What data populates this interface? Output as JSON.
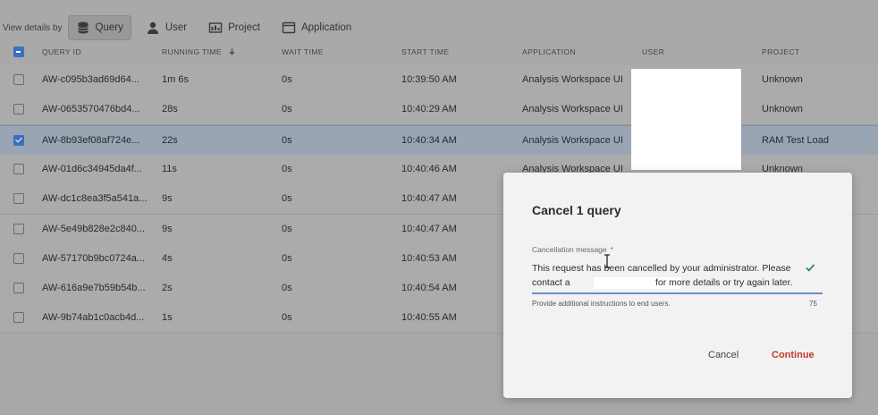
{
  "viewbar": {
    "label": "View details by",
    "buttons": [
      {
        "label": "Query",
        "icon": "database-icon",
        "active": true
      },
      {
        "label": "User",
        "icon": "user-icon",
        "active": false
      },
      {
        "label": "Project",
        "icon": "project-icon",
        "active": false
      },
      {
        "label": "Application",
        "icon": "application-icon",
        "active": false
      }
    ]
  },
  "table": {
    "headers": {
      "query_id": "QUERY ID",
      "running_time": "RUNNING TIME",
      "wait_time": "WAIT TIME",
      "start_time": "START TIME",
      "application": "APPLICATION",
      "user": "USER",
      "project": "PROJECT"
    },
    "sort_icon": "arrow-down-icon",
    "rows": [
      {
        "query_id": "AW-c095b3ad69d64...",
        "running_time": "1m 6s",
        "wait_time": "0s",
        "start_time": "10:39:50 AM",
        "application": "Analysis Workspace UI",
        "project": "Unknown",
        "checked": false
      },
      {
        "query_id": "AW-0653570476bd4...",
        "running_time": "28s",
        "wait_time": "0s",
        "start_time": "10:40:29 AM",
        "application": "Analysis Workspace UI",
        "project": "Unknown",
        "checked": false
      },
      {
        "query_id": "AW-8b93ef08af724e...",
        "running_time": "22s",
        "wait_time": "0s",
        "start_time": "10:40:34 AM",
        "application": "Analysis Workspace UI",
        "project": "RAM Test Load",
        "checked": true
      },
      {
        "query_id": "AW-01d6c34945da4f...",
        "running_time": "11s",
        "wait_time": "0s",
        "start_time": "10:40:46 AM",
        "application": "Analysis Workspace UI",
        "project": "Unknown",
        "checked": false
      },
      {
        "query_id": "AW-dc1c8ea3f5a541a...",
        "running_time": "9s",
        "wait_time": "0s",
        "start_time": "10:40:47 AM",
        "application": "",
        "project": "",
        "checked": false
      },
      {
        "query_id": "AW-5e49b828e2c840...",
        "running_time": "9s",
        "wait_time": "0s",
        "start_time": "10:40:47 AM",
        "application": "",
        "project": "",
        "checked": false
      },
      {
        "query_id": "AW-57170b9bc0724a...",
        "running_time": "4s",
        "wait_time": "0s",
        "start_time": "10:40:53 AM",
        "application": "",
        "project": "",
        "checked": false
      },
      {
        "query_id": "AW-616a9e7b59b54b...",
        "running_time": "2s",
        "wait_time": "0s",
        "start_time": "10:40:54 AM",
        "application": "",
        "project": "",
        "checked": false
      },
      {
        "query_id": "AW-9b74ab1c0acb4d...",
        "running_time": "1s",
        "wait_time": "0s",
        "start_time": "10:40:55 AM",
        "application": "",
        "project": "",
        "checked": false
      }
    ]
  },
  "dialog": {
    "title": "Cancel 1 query",
    "field_label": "Cancellation message",
    "required_mark": "*",
    "message_line1": "This request has been cancelled by your administrator. Please",
    "message_line2_start": "contact a",
    "message_line2_end": "for more details or try again later.",
    "help_text": "Provide additional instructions to end users.",
    "char_count": "75",
    "cancel_label": "Cancel",
    "continue_label": "Continue"
  },
  "colors": {
    "accent": "#3c6fbf",
    "continue": "#c0392b",
    "valid_check": "#2d8a4e"
  }
}
